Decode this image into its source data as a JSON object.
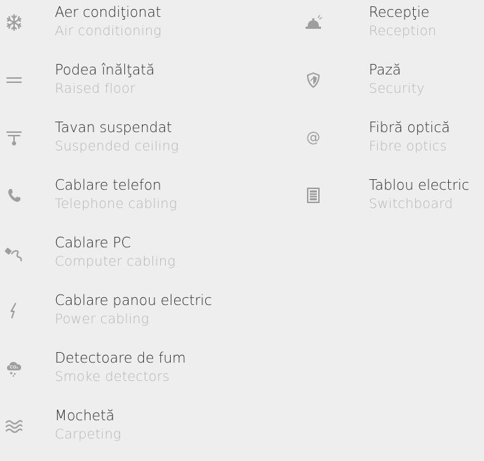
{
  "colors": {
    "icon": "#9e9e9e",
    "primary_text": "#2c2c2c",
    "secondary_text": "#b6b6b6",
    "background": "#eeeeee"
  },
  "left_items": [
    {
      "ro": "Aer condiţionat",
      "en": "Air conditioning",
      "icon": "snowflake-icon"
    },
    {
      "ro": "Podea înălţată",
      "en": "Raised floor",
      "icon": "raised-floor-icon"
    },
    {
      "ro": "Tavan suspendat",
      "en": "Suspended ceiling",
      "icon": "suspended-ceiling-icon"
    },
    {
      "ro": "Cablare telefon",
      "en": "Telephone cabling",
      "icon": "phone-icon"
    },
    {
      "ro": "Cablare PC",
      "en": "Computer cabling",
      "icon": "network-cable-icon"
    },
    {
      "ro": "Cablare panou electric",
      "en": "Power cabling",
      "icon": "lightning-icon"
    },
    {
      "ro": "Detectoare de fum",
      "en": "Smoke detectors",
      "icon": "smoke-detector-icon"
    },
    {
      "ro": "Mochetă",
      "en": "Carpeting",
      "icon": "carpet-waves-icon"
    }
  ],
  "right_items": [
    {
      "ro": "Recepţie",
      "en": "Reception",
      "icon": "reception-bell-icon"
    },
    {
      "ro": "Pază",
      "en": "Security",
      "icon": "shield-icon"
    },
    {
      "ro": "Fibră optică",
      "en": "Fibre optics",
      "icon": "at-sign-icon"
    },
    {
      "ro": "Tablou electric",
      "en": "Switchboard",
      "icon": "switchboard-icon"
    }
  ]
}
